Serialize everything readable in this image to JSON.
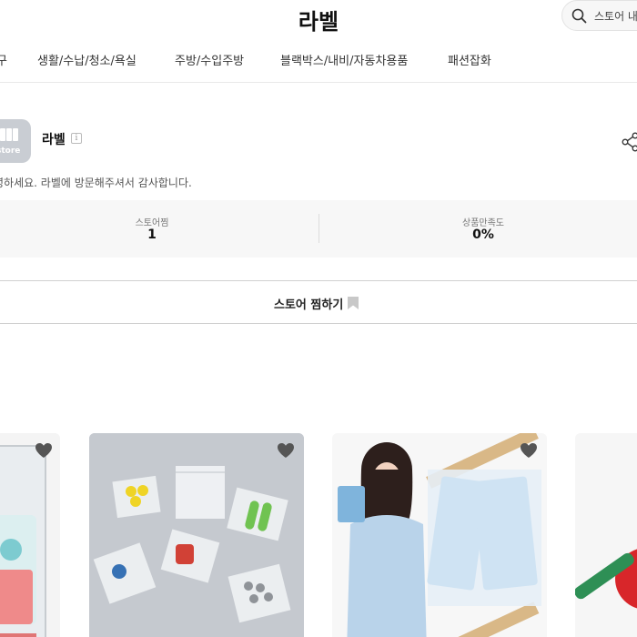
{
  "header": {
    "title": "라벨",
    "search_placeholder": "스토어 내"
  },
  "nav": {
    "items": [
      {
        "label": "구"
      },
      {
        "label": "생활/수납/청소/욕실"
      },
      {
        "label": "주방/수입주방"
      },
      {
        "label": "블랙박스/내비/자동차용품"
      },
      {
        "label": "패션잡화"
      }
    ]
  },
  "store": {
    "logo_text": "store",
    "name": "라벨",
    "info_icon": "i",
    "greeting": "녕하세요. 라벨에 방문해주셔서 감사합니다."
  },
  "stats": [
    {
      "label": "스토어찜",
      "value": "1"
    },
    {
      "label": "상품만족도",
      "value": "0%"
    }
  ],
  "follow": {
    "label": "스토어 찜하기"
  },
  "products": [
    {
      "name": "clear-phone-case",
      "icon": "heart-icon"
    },
    {
      "name": "zipper-bags",
      "icon": "heart-icon"
    },
    {
      "name": "disposable-raincoat",
      "icon": "heart-icon"
    },
    {
      "name": "red-product",
      "icon": "heart-icon"
    }
  ],
  "colors": {
    "heart": "#555555",
    "stats_bg": "#f7f7f7",
    "divider": "#e8e8e8"
  }
}
